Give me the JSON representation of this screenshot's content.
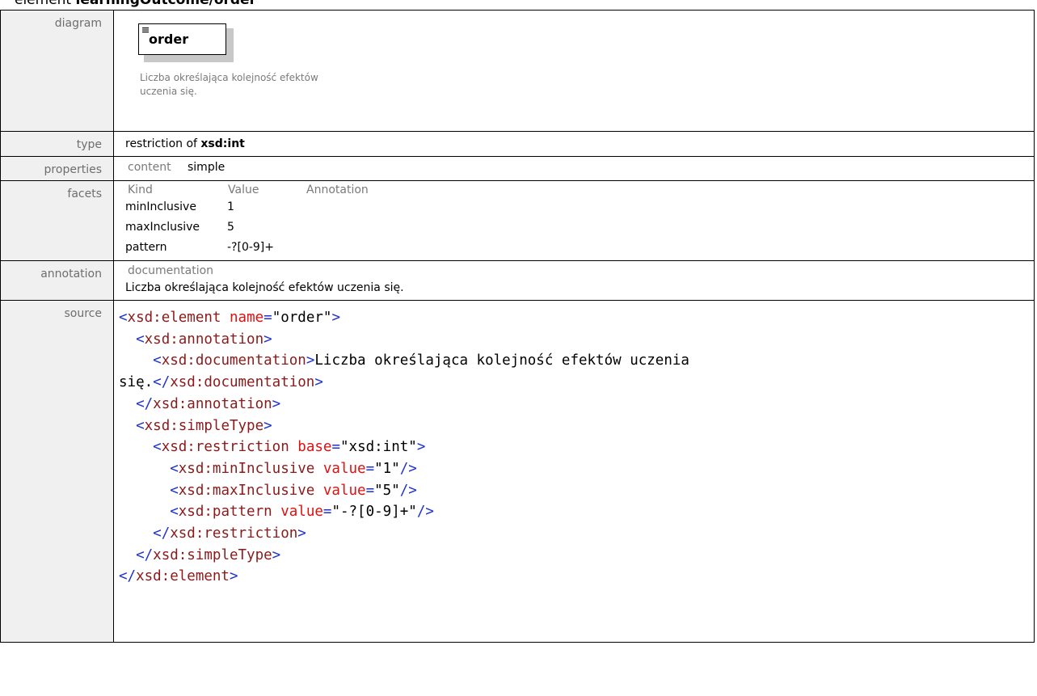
{
  "heading": {
    "prefix": "element ",
    "name": "learningOutcome/order"
  },
  "rows": {
    "diagram": {
      "label": "diagram",
      "element_name": "order",
      "doc": "Liczba określająca kolejność efektów uczenia się."
    },
    "type": {
      "label": "type",
      "prefix": "restriction of ",
      "base": "xsd:int"
    },
    "properties": {
      "label": "properties",
      "key": "content",
      "value": "simple"
    },
    "facets": {
      "label": "facets",
      "headers": [
        "Kind",
        "Value",
        "Annotation"
      ],
      "items": [
        {
          "kind": "minInclusive",
          "value": "1",
          "annotation": ""
        },
        {
          "kind": "maxInclusive",
          "value": "5",
          "annotation": ""
        },
        {
          "kind": "pattern",
          "value": "-?[0-9]+",
          "annotation": ""
        }
      ]
    },
    "annotation": {
      "label": "annotation",
      "head": "documentation",
      "text": "Liczba określająca kolejność efektów uczenia się."
    },
    "source": {
      "label": "source",
      "lines": [
        [
          [
            "p",
            "<"
          ],
          [
            "t",
            "xsd:element"
          ],
          [
            "v",
            " "
          ],
          [
            "a",
            "name"
          ],
          [
            "p",
            "="
          ],
          [
            "v",
            "\"order\""
          ],
          [
            "p",
            ">"
          ]
        ],
        [
          [
            "v",
            "  "
          ],
          [
            "p",
            "<"
          ],
          [
            "t",
            "xsd:annotation"
          ],
          [
            "p",
            ">"
          ]
        ],
        [
          [
            "v",
            "    "
          ],
          [
            "p",
            "<"
          ],
          [
            "t",
            "xsd:documentation"
          ],
          [
            "p",
            ">"
          ],
          [
            "v",
            "Liczba określająca kolejność efektów uczenia"
          ]
        ],
        [
          [
            "v",
            "się."
          ],
          [
            "p",
            "</"
          ],
          [
            "t",
            "xsd:documentation"
          ],
          [
            "p",
            ">"
          ]
        ],
        [
          [
            "v",
            "  "
          ],
          [
            "p",
            "</"
          ],
          [
            "t",
            "xsd:annotation"
          ],
          [
            "p",
            ">"
          ]
        ],
        [
          [
            "v",
            "  "
          ],
          [
            "p",
            "<"
          ],
          [
            "t",
            "xsd:simpleType"
          ],
          [
            "p",
            ">"
          ]
        ],
        [
          [
            "v",
            "    "
          ],
          [
            "p",
            "<"
          ],
          [
            "t",
            "xsd:restriction"
          ],
          [
            "v",
            " "
          ],
          [
            "a",
            "base"
          ],
          [
            "p",
            "="
          ],
          [
            "v",
            "\"xsd:int\""
          ],
          [
            "p",
            ">"
          ]
        ],
        [
          [
            "v",
            "      "
          ],
          [
            "p",
            "<"
          ],
          [
            "t",
            "xsd:minInclusive"
          ],
          [
            "v",
            " "
          ],
          [
            "a",
            "value"
          ],
          [
            "p",
            "="
          ],
          [
            "v",
            "\"1\""
          ],
          [
            "p",
            "/>"
          ]
        ],
        [
          [
            "v",
            "      "
          ],
          [
            "p",
            "<"
          ],
          [
            "t",
            "xsd:maxInclusive"
          ],
          [
            "v",
            " "
          ],
          [
            "a",
            "value"
          ],
          [
            "p",
            "="
          ],
          [
            "v",
            "\"5\""
          ],
          [
            "p",
            "/>"
          ]
        ],
        [
          [
            "v",
            "      "
          ],
          [
            "p",
            "<"
          ],
          [
            "t",
            "xsd:pattern"
          ],
          [
            "v",
            " "
          ],
          [
            "a",
            "value"
          ],
          [
            "p",
            "="
          ],
          [
            "v",
            "\"-?[0-9]+\""
          ],
          [
            "p",
            "/>"
          ]
        ],
        [
          [
            "v",
            "    "
          ],
          [
            "p",
            "</"
          ],
          [
            "t",
            "xsd:restriction"
          ],
          [
            "p",
            ">"
          ]
        ],
        [
          [
            "v",
            "  "
          ],
          [
            "p",
            "</"
          ],
          [
            "t",
            "xsd:simpleType"
          ],
          [
            "p",
            ">"
          ]
        ],
        [
          [
            "p",
            "</"
          ],
          [
            "t",
            "xsd:element"
          ],
          [
            "p",
            ">"
          ]
        ]
      ]
    }
  }
}
